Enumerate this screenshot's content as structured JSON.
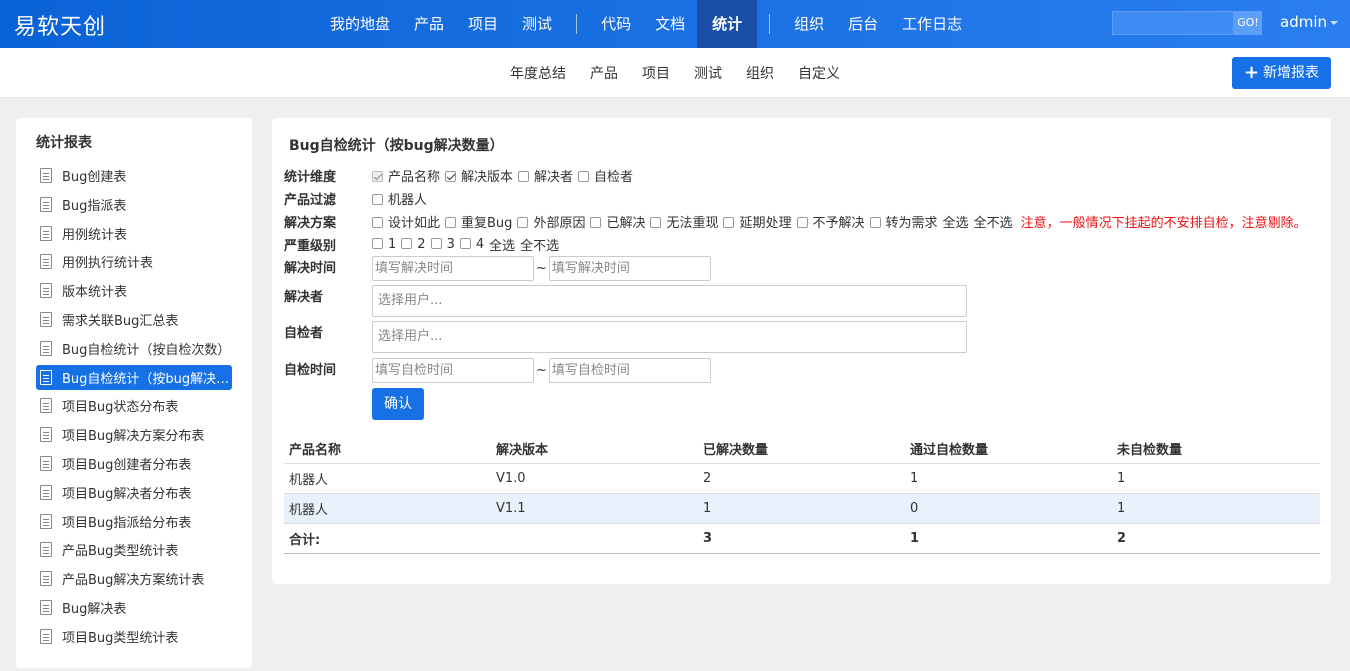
{
  "brand": "易软天创",
  "nav": {
    "items": [
      "我的地盘",
      "产品",
      "项目",
      "测试"
    ],
    "items2": [
      "代码",
      "文档",
      "统计"
    ],
    "items3": [
      "组织",
      "后台",
      "工作日志"
    ],
    "active": "统计",
    "search_button": "GO!",
    "user": "admin"
  },
  "subnav": {
    "items": [
      "年度总结",
      "产品",
      "项目",
      "测试",
      "组织",
      "自定义"
    ],
    "new_report": "新增报表"
  },
  "sidebar": {
    "title": "统计报表",
    "items": [
      "Bug创建表",
      "Bug指派表",
      "用例统计表",
      "用例执行统计表",
      "版本统计表",
      "需求关联Bug汇总表",
      "Bug自检统计（按自检次数）",
      "Bug自检统计（按bug解决数量）",
      "项目Bug状态分布表",
      "项目Bug解决方案分布表",
      "项目Bug创建者分布表",
      "项目Bug解决者分布表",
      "项目Bug指派给分布表",
      "产品Bug类型统计表",
      "产品Bug解决方案统计表",
      "Bug解决表",
      "项目Bug类型统计表"
    ],
    "active_index": 7
  },
  "main": {
    "title": "Bug自检统计（按bug解决数量）",
    "filters": {
      "dimension_label": "统计维度",
      "dimension_options": [
        "产品名称",
        "解决版本",
        "解决者",
        "自检者"
      ],
      "product_label": "产品过滤",
      "product_options": [
        "机器人"
      ],
      "resolution_label": "解决方案",
      "resolution_options": [
        "设计如此",
        "重复Bug",
        "外部原因",
        "已解决",
        "无法重现",
        "延期处理",
        "不予解决",
        "转为需求"
      ],
      "select_all": "全选",
      "select_none": "全不选",
      "notice": "注意，一般情况下挂起的不安排自检，注意剔除。",
      "severity_label": "严重级别",
      "severity_options": [
        "1",
        "2",
        "3",
        "4"
      ],
      "resolve_time_label": "解决时间",
      "resolve_time_placeholder": "填写解决时间",
      "resolver_label": "解决者",
      "user_placeholder": "选择用户...",
      "checker_label": "自检者",
      "check_time_label": "自检时间",
      "check_time_placeholder": "填写自检时间",
      "tilde": "~",
      "confirm": "确认"
    },
    "table": {
      "headers": [
        "产品名称",
        "解决版本",
        "已解决数量",
        "通过自检数量",
        "未自检数量"
      ],
      "rows": [
        [
          "机器人",
          "V1.0",
          "2",
          "1",
          "1"
        ],
        [
          "机器人",
          "V1.1",
          "1",
          "0",
          "1"
        ]
      ],
      "total": [
        "合计:",
        "",
        "3",
        "1",
        "2"
      ]
    }
  }
}
